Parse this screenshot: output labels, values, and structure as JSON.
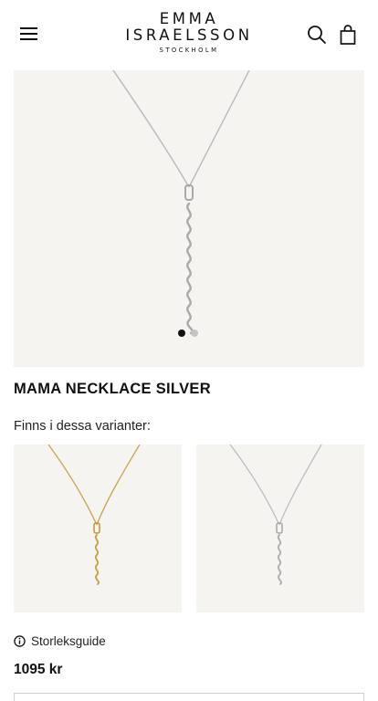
{
  "header": {
    "menu_icon": "hamburger-menu-icon",
    "logo": {
      "line1": "EMMA",
      "line2": "ISRAELSSON",
      "line3": "STOCKHOLM"
    },
    "search_icon": "search-icon",
    "bag_icon": "shopping-bag-icon"
  },
  "gallery": {
    "slide_count": 2,
    "active_slide": 1
  },
  "product": {
    "title": "MAMA NECKLACE SILVER",
    "variants_label": "Finns i dessa varianter:",
    "variants": [
      {
        "metal": "gold",
        "color": "#c9a54a"
      },
      {
        "metal": "silver",
        "color": "#bdbdbd"
      }
    ],
    "size_guide_label": "Storleksguide",
    "size_guide_icon": "info-icon",
    "price": "1095 kr"
  },
  "colors": {
    "text": "#111111",
    "image_bg": "#f6f4f1",
    "dot_active": "#111111",
    "dot_inactive": "#c4c4c4"
  }
}
